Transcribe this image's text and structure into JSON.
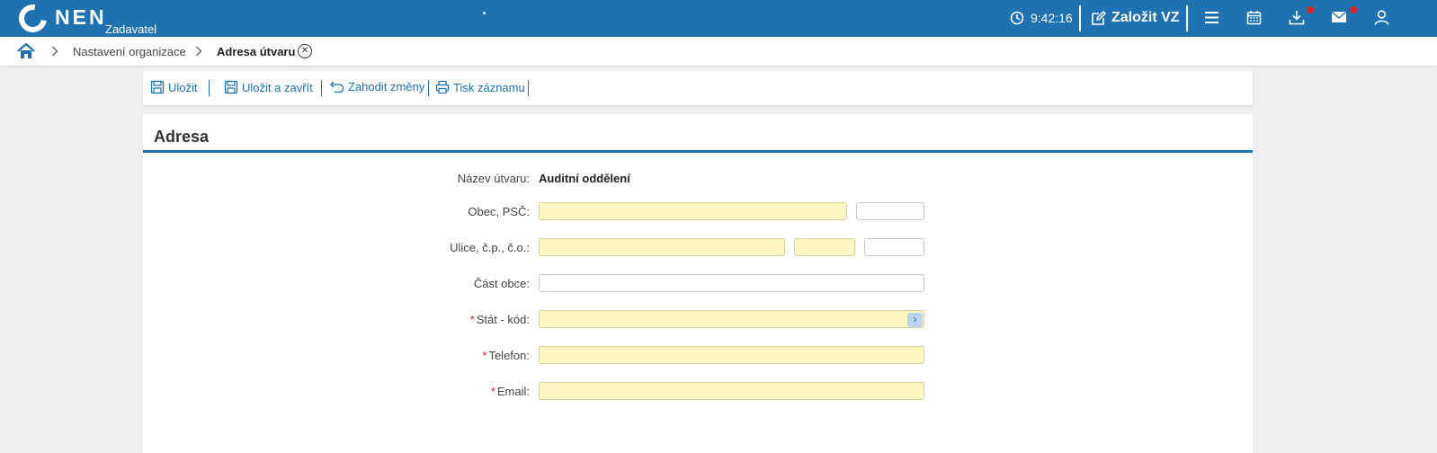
{
  "header": {
    "brand": "NEN",
    "subtitle": "Zadavatel",
    "time": "9:42:16",
    "create_label": "Založit VZ",
    "icons": [
      "clock-icon",
      "edit-icon",
      "menu-icon",
      "calendar-icon",
      "download-icon",
      "mail-icon",
      "user-icon"
    ],
    "accent": "#1f72b1",
    "notification_color": "#e0231b"
  },
  "breadcrumb": {
    "items": [
      "Nastavení organizace",
      "Adresa útvaru"
    ],
    "close_symbol": "✕"
  },
  "toolbar": {
    "save": "Uložit",
    "save_close": "Uložit a zavřít",
    "discard": "Zahodit změny",
    "print": "Tisk záznamu"
  },
  "form": {
    "title": "Adresa",
    "fields": {
      "unit_name": {
        "label": "Název útvaru:",
        "value": "Auditní oddělení"
      },
      "city": {
        "label": "Obec, PSČ:",
        "city_value": "",
        "zip_value": ""
      },
      "street": {
        "label": "Ulice, č.p., č.o.:",
        "street_value": "",
        "house_no": "",
        "orient_no": ""
      },
      "district": {
        "label": "Část obce:",
        "value": ""
      },
      "country": {
        "label": "Stát - kód:",
        "required": "*",
        "value": ""
      },
      "phone": {
        "label": "Telefon:",
        "required": "*",
        "value": ""
      },
      "email": {
        "label": "Email:",
        "required": "*",
        "value": ""
      }
    },
    "required_bg": "#fdf6c0"
  }
}
